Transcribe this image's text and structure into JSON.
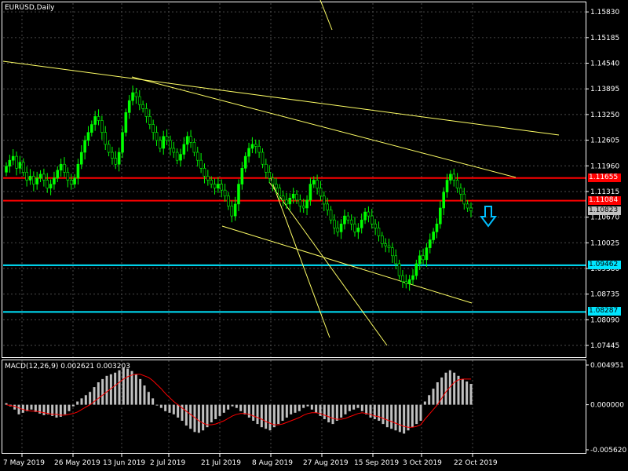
{
  "chart_window": {
    "title": "EURUSD,Daily",
    "background": "#000000",
    "foreground": "#ffffff",
    "grid_color": "#4a4a4a",
    "bull_color": "#00ff00",
    "bear_color": "#000000",
    "candle_outline": "#00ff00",
    "price_axis_labels": [
      "1.15830",
      "1.15185",
      "1.14540",
      "1.13895",
      "1.13250",
      "1.12605",
      "1.11960",
      "1.11315",
      "1.10670",
      "1.10025",
      "1.09380",
      "1.08735",
      "1.08090",
      "1.07445"
    ],
    "date_axis_labels": [
      "7 May 2019",
      "26 May 2019",
      "13 Jun 2019",
      "2 Jul 2019",
      "21 Jul 2019",
      "8 Aug 2019",
      "27 Aug 2019",
      "15 Sep 2019",
      "3 Oct 2019",
      "22 Oct 2019"
    ],
    "price_tags": [
      {
        "text": "1.11655",
        "bg": "#ff0000",
        "fg": "#ffffff"
      },
      {
        "text": "1.11084",
        "bg": "#ff0000",
        "fg": "#ffffff"
      },
      {
        "text": "1.10823",
        "bg": "#c0c0c0",
        "fg": "#000000"
      },
      {
        "text": "1.09462",
        "bg": "#00e5ff",
        "fg": "#000000"
      },
      {
        "text": "1.08287",
        "bg": "#00e5ff",
        "fg": "#000000"
      }
    ],
    "horizontal_levels": [
      {
        "price": 1.11655,
        "color": "#ff0000"
      },
      {
        "price": 1.11084,
        "color": "#ff0000"
      },
      {
        "price": 1.09462,
        "color": "#00e5ff"
      },
      {
        "price": 1.08287,
        "color": "#00e5ff"
      }
    ],
    "trendline_color": "#ffff66",
    "signal_arrow": {
      "icon": "down-arrow-icon",
      "color": "#00bfff"
    }
  },
  "macd_window": {
    "title": "MACD(12,26,9) 0.002621 0.003203",
    "axis_labels": [
      "0.004951",
      "0.000000",
      "-0.005620"
    ],
    "histogram_color": "#c0c0c0",
    "signal_color": "#ff0000"
  },
  "chart_data": {
    "type": "candlestick",
    "title": "EURUSD,Daily",
    "ylim": [
      1.0715,
      1.1605
    ],
    "x_tick_labels": [
      "7 May 2019",
      "26 May 2019",
      "13 Jun 2019",
      "2 Jul 2019",
      "21 Jul 2019",
      "8 Aug 2019",
      "27 Aug 2019",
      "15 Sep 2019",
      "3 Oct 2019",
      "22 Oct 2019"
    ],
    "close": [
      1.1195,
      1.121,
      1.122,
      1.119,
      1.1205,
      1.118,
      1.116,
      1.117,
      1.115,
      1.1165,
      1.1175,
      1.116,
      1.114,
      1.115,
      1.1165,
      1.1185,
      1.12,
      1.118,
      1.116,
      1.115,
      1.1165,
      1.12,
      1.123,
      1.126,
      1.128,
      1.13,
      1.132,
      1.131,
      1.128,
      1.125,
      1.123,
      1.1215,
      1.12,
      1.123,
      1.128,
      1.133,
      1.136,
      1.138,
      1.137,
      1.135,
      1.134,
      1.132,
      1.13,
      1.128,
      1.126,
      1.124,
      1.127,
      1.126,
      1.124,
      1.123,
      1.121,
      1.1225,
      1.125,
      1.127,
      1.1255,
      1.123,
      1.121,
      1.119,
      1.117,
      1.116,
      1.115,
      1.114,
      1.115,
      1.1135,
      1.112,
      1.1095,
      1.107,
      1.11,
      1.115,
      1.119,
      1.122,
      1.124,
      1.125,
      1.1245,
      1.123,
      1.12,
      1.118,
      1.1165,
      1.115,
      1.114,
      1.112,
      1.111,
      1.11,
      1.1115,
      1.1125,
      1.111,
      1.1095,
      1.109,
      1.111,
      1.115,
      1.116,
      1.114,
      1.112,
      1.11,
      1.1085,
      1.106,
      1.104,
      1.103,
      1.105,
      1.107,
      1.106,
      1.105,
      1.103,
      1.104,
      1.106,
      1.108,
      1.107,
      1.105,
      1.104,
      1.102,
      1.1,
      1.0995,
      1.099,
      1.097,
      1.095,
      1.092,
      1.0905,
      1.09,
      1.091,
      1.092,
      1.095,
      1.097,
      1.096,
      1.099,
      1.101,
      1.103,
      1.105,
      1.109,
      1.113,
      1.116,
      1.1175,
      1.116,
      1.114,
      1.1125,
      1.11,
      1.109,
      1.1083
    ],
    "macd": [
      0.0002,
      -0.0002,
      -0.0006,
      -0.0012,
      -0.001,
      -0.0008,
      -0.0006,
      -0.0009,
      -0.0011,
      -0.0013,
      -0.0012,
      -0.0014,
      -0.0016,
      -0.0015,
      -0.0012,
      -0.0008,
      -0.0002,
      0.0004,
      0.0008,
      0.0012,
      0.0016,
      0.0022,
      0.0028,
      0.0032,
      0.0036,
      0.0038,
      0.004,
      0.0043,
      0.0046,
      0.0045,
      0.0042,
      0.0038,
      0.0032,
      0.0024,
      0.0016,
      0.0008,
      0.0,
      -0.0004,
      -0.0008,
      -0.001,
      -0.0012,
      -0.0016,
      -0.002,
      -0.0026,
      -0.003,
      -0.0034,
      -0.0035,
      -0.0032,
      -0.0028,
      -0.0022,
      -0.0018,
      -0.0014,
      -0.001,
      -0.0006,
      -0.0002,
      -0.0004,
      -0.0008,
      -0.0012,
      -0.0016,
      -0.002,
      -0.0024,
      -0.0028,
      -0.003,
      -0.0032,
      -0.0028,
      -0.0024,
      -0.002,
      -0.0016,
      -0.0012,
      -0.001,
      -0.0008,
      -0.0004,
      -0.0002,
      -0.0006,
      -0.001,
      -0.0014,
      -0.0018,
      -0.0022,
      -0.0024,
      -0.002,
      -0.0016,
      -0.0012,
      -0.0008,
      -0.0006,
      -0.0004,
      -0.0008,
      -0.0012,
      -0.0016,
      -0.0018,
      -0.002,
      -0.0024,
      -0.0028,
      -0.003,
      -0.0032,
      -0.0034,
      -0.0036,
      -0.0032,
      -0.0028,
      -0.0024,
      -0.002,
      0.0004,
      0.0012,
      0.002,
      0.0028,
      0.0034,
      0.004,
      0.0043,
      0.004,
      0.0036,
      0.0032,
      0.0029,
      0.0026
    ],
    "signal": [
      0.0,
      -0.0001,
      -0.0002,
      -0.0004,
      -0.0006,
      -0.0007,
      -0.0008,
      -0.0008,
      -0.0009,
      -0.001,
      -0.0011,
      -0.0012,
      -0.0012,
      -0.0013,
      -0.0013,
      -0.0012,
      -0.0011,
      -0.0009,
      -0.0006,
      -0.0003,
      0.0,
      0.0004,
      0.0008,
      0.0012,
      0.0016,
      0.002,
      0.0024,
      0.0028,
      0.0032,
      0.0035,
      0.0037,
      0.0038,
      0.0038,
      0.0036,
      0.0034,
      0.003,
      0.0025,
      0.002,
      0.0014,
      0.0009,
      0.0004,
      0.0,
      -0.0004,
      -0.0008,
      -0.0012,
      -0.0016,
      -0.002,
      -0.0023,
      -0.0025,
      -0.0025,
      -0.0024,
      -0.0022,
      -0.002,
      -0.0017,
      -0.0014,
      -0.0012,
      -0.0011,
      -0.0011,
      -0.0012,
      -0.0014,
      -0.0016,
      -0.0018,
      -0.0021,
      -0.0023,
      -0.0025,
      -0.0025,
      -0.0024,
      -0.0022,
      -0.002,
      -0.0018,
      -0.0016,
      -0.0013,
      -0.0011,
      -0.001,
      -0.001,
      -0.0011,
      -0.0013,
      -0.0015,
      -0.0017,
      -0.0018,
      -0.0018,
      -0.0017,
      -0.0015,
      -0.0013,
      -0.0011,
      -0.001,
      -0.0011,
      -0.0012,
      -0.0014,
      -0.0015,
      -0.0017,
      -0.0019,
      -0.0021,
      -0.0023,
      -0.0025,
      -0.0027,
      -0.0028,
      -0.0028,
      -0.0027,
      -0.0025,
      -0.0018,
      -0.0012,
      -0.0006,
      0.0,
      0.0008,
      0.0016,
      0.0022,
      0.0028,
      0.0031,
      0.0032,
      0.0032,
      0.0032
    ]
  }
}
